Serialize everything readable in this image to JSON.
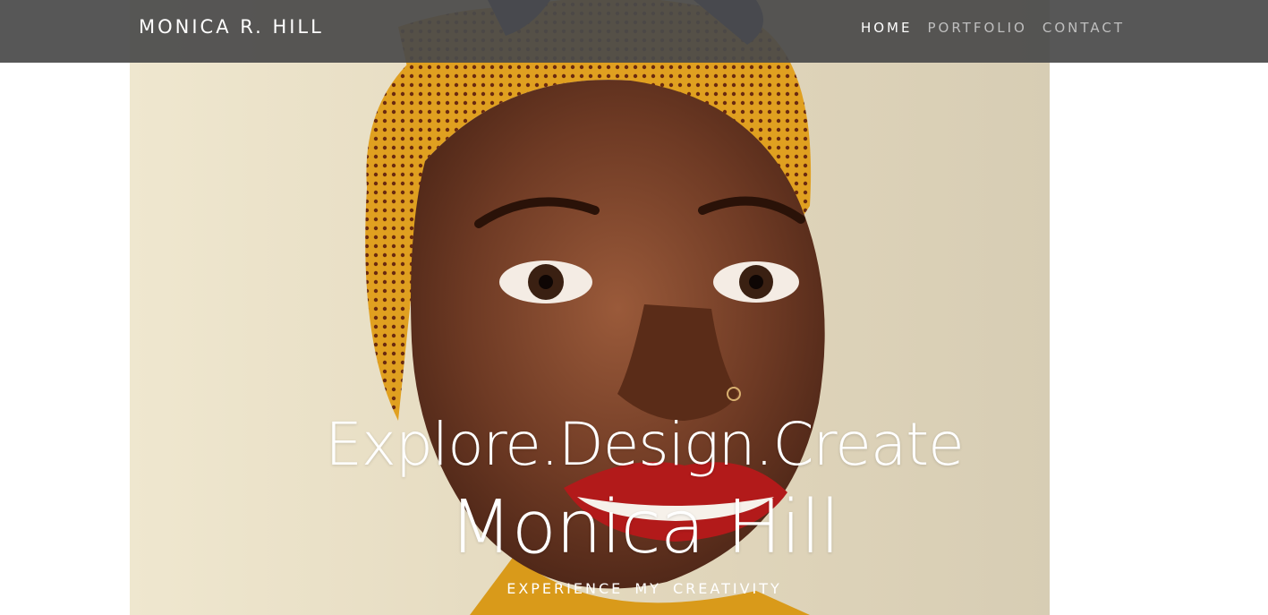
{
  "brand": {
    "name": "MONICA R. HILL"
  },
  "nav": {
    "items": [
      {
        "label": "HOME",
        "active": true
      },
      {
        "label": "PORTFOLIO",
        "active": false
      },
      {
        "label": "CONTACT",
        "active": false
      }
    ]
  },
  "hero": {
    "tagline": "Explore.Design.Create",
    "name": "Monica Hill",
    "subtitle": "EXPERIENCE  MY  CREATIVITY",
    "image_subject": "portrait-photo"
  },
  "colors": {
    "navbar": "#4a4a4a",
    "nav_active": "#ffffff",
    "nav_inactive": "#bfbfbf",
    "hero_text": "#ffffff"
  }
}
